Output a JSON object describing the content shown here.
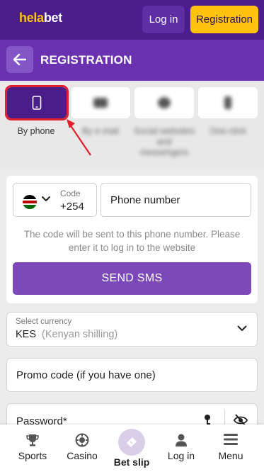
{
  "header": {
    "logo_part1": "hela",
    "logo_part2": "bet",
    "login_label": "Log in",
    "register_label": "Registration"
  },
  "title_bar": {
    "title": "REGISTRATION",
    "back_icon": "arrow-left-icon"
  },
  "methods": [
    {
      "label": "By phone",
      "icon": "phone-icon",
      "active": true
    },
    {
      "label": "By e-mail",
      "icon": "email-icon",
      "active": false
    },
    {
      "label": "Social websites and messengers",
      "icon": "social-icon",
      "active": false
    },
    {
      "label": "One-click",
      "icon": "one-click-icon",
      "active": false
    }
  ],
  "phone_form": {
    "country_flag": "kenya-flag-icon",
    "code_label": "Code",
    "code_value": "+254",
    "phone_placeholder": "Phone number",
    "hint": "The code will be sent to this phone number. Please enter it to log in to the website",
    "send_label": "SEND SMS"
  },
  "currency": {
    "label": "Select currency",
    "value": "KES",
    "value_sub": "(Kenyan shilling)"
  },
  "promo": {
    "placeholder": "Promo code (if you have one)"
  },
  "password": {
    "label": "Password*"
  },
  "bottom_nav": {
    "sports": "Sports",
    "casino": "Casino",
    "betslip": "Bet slip",
    "login": "Log in",
    "menu": "Menu"
  },
  "colors": {
    "header_bg": "#4a1d8a",
    "title_bg": "#6a32b0",
    "accent_yellow": "#ffc20e",
    "send_button": "#7b4ab8",
    "highlight_red": "#e0202e"
  }
}
